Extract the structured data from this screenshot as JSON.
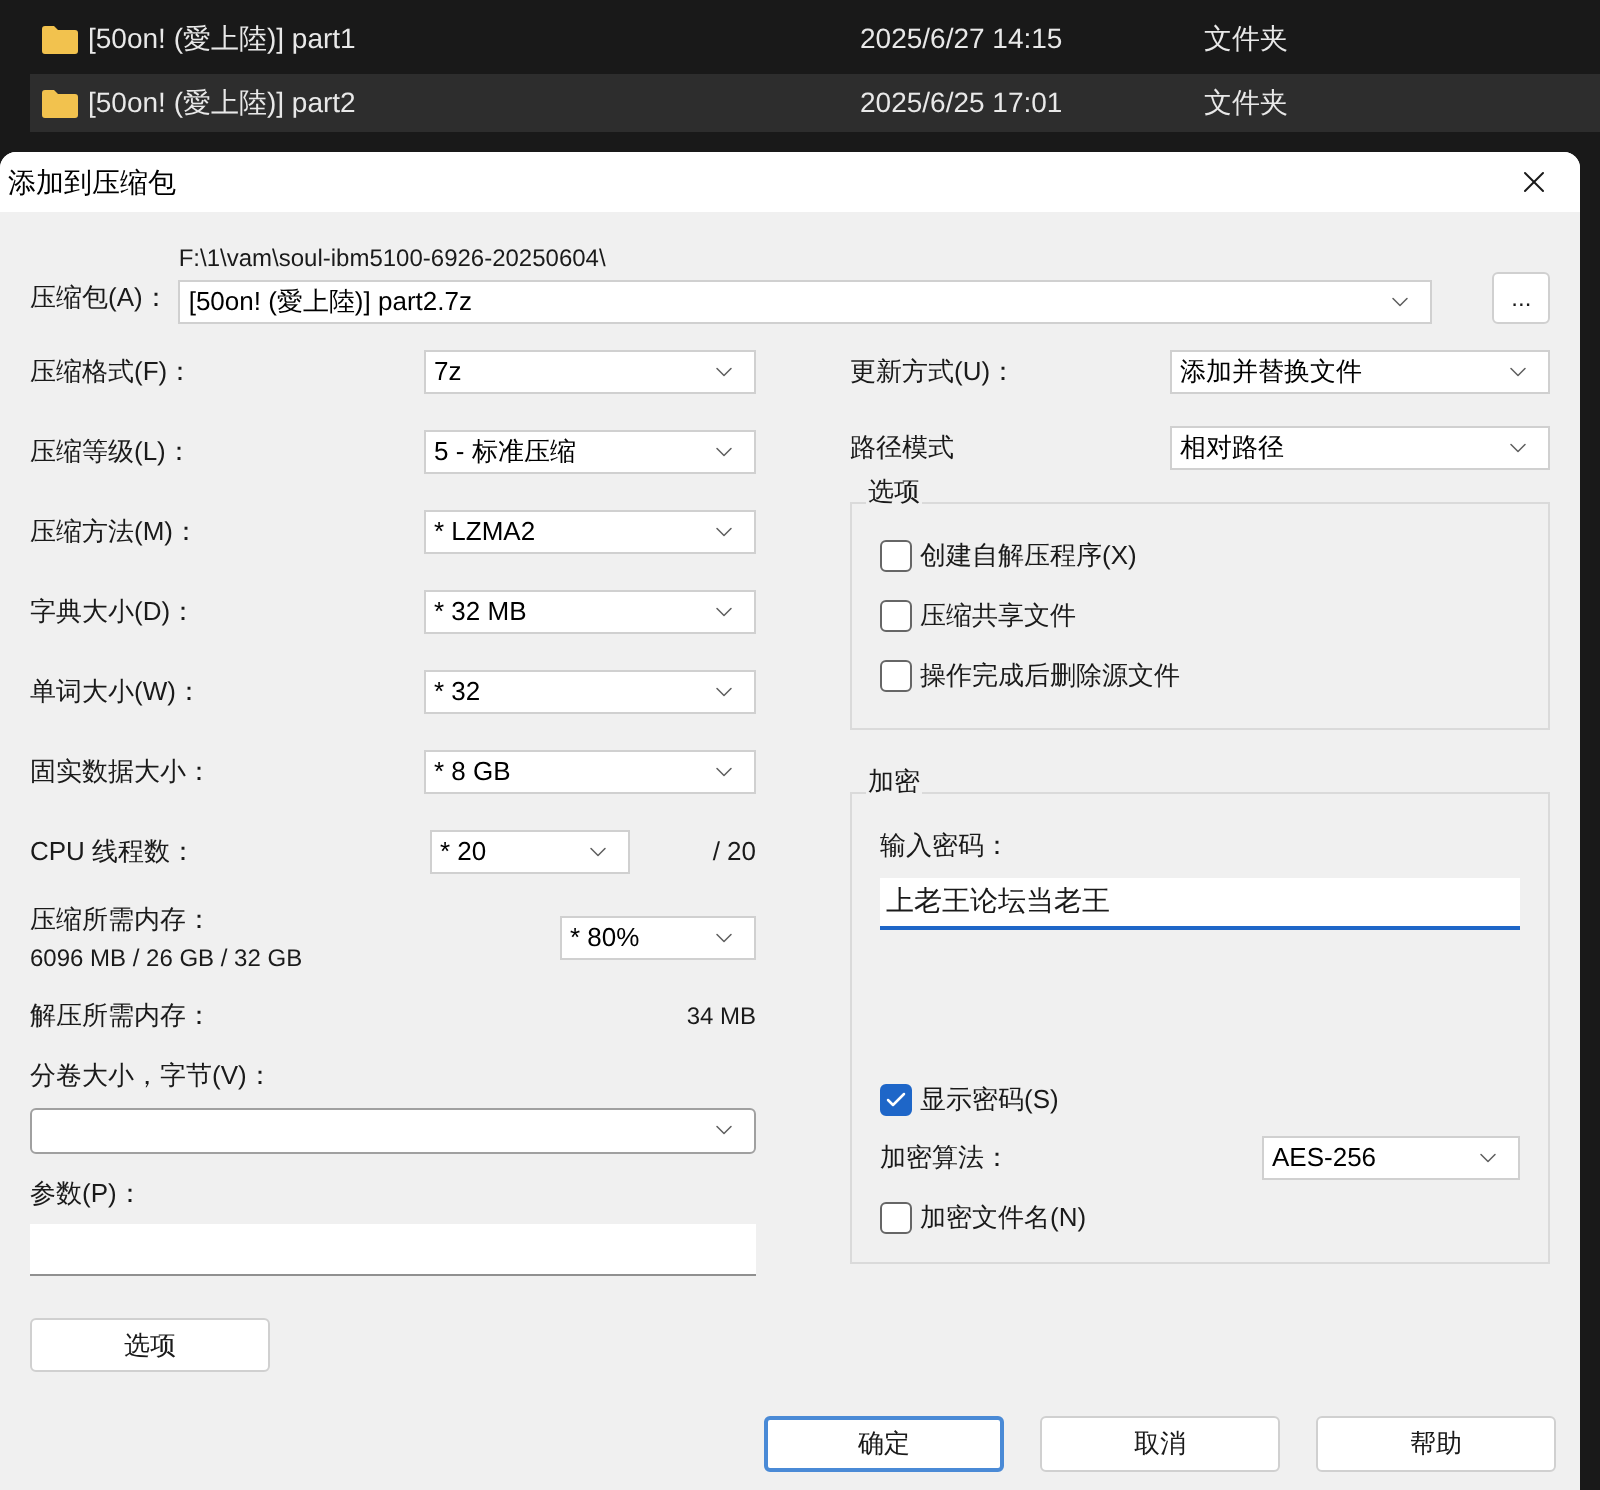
{
  "explorer_rows": [
    {
      "name": "[50on! (愛上陸)] part1",
      "date": "2025/6/27 14:15",
      "type": "文件夹",
      "selected": false
    },
    {
      "name": "[50on! (愛上陸)] part2",
      "date": "2025/6/25 17:01",
      "type": "文件夹",
      "selected": true
    }
  ],
  "dialog": {
    "title": "添加到压缩包",
    "archive": {
      "label": "压缩包(A)：",
      "path": "F:\\1\\vam\\soul-ibm5100-6926-20250604\\",
      "value": "[50on! (愛上陸)] part2.7z",
      "browse": "..."
    },
    "left": [
      {
        "kind": "select",
        "label": "压缩格式(F)：",
        "value": "7z"
      },
      {
        "kind": "select",
        "label": "压缩等级(L)：",
        "value": "5 - 标准压缩"
      },
      {
        "kind": "select",
        "label": "压缩方法(M)：",
        "value": "* LZMA2"
      },
      {
        "kind": "select",
        "label": "字典大小(D)：",
        "value": "* 32 MB"
      },
      {
        "kind": "select",
        "label": "单词大小(W)：",
        "value": "* 32"
      },
      {
        "kind": "select",
        "label": "固实数据大小：",
        "value": "* 8 GB"
      },
      {
        "kind": "threads",
        "label": "CPU 线程数：",
        "value": "* 20",
        "suffix": "/ 20"
      },
      {
        "kind": "memory",
        "label": "压缩所需内存：",
        "detail": "6096 MB / 26 GB / 32 GB",
        "value": "* 80%"
      },
      {
        "kind": "info",
        "label": "解压所需内存：",
        "value": "34 MB"
      },
      {
        "kind": "combo",
        "label": "分卷大小，字节(V)："
      },
      {
        "kind": "field",
        "label": "参数(P)："
      }
    ],
    "options_button": "选项",
    "update": {
      "label": "更新方式(U)：",
      "value": "添加并替换文件"
    },
    "path_mode": {
      "label": "路径模式",
      "value": "相对路径"
    },
    "options": {
      "title": "选项",
      "items": [
        {
          "label": "创建自解压程序(X)",
          "checked": false
        },
        {
          "label": "压缩共享文件",
          "checked": false
        },
        {
          "label": "操作完成后删除源文件",
          "checked": false
        }
      ]
    },
    "encryption": {
      "title": "加密",
      "password_label": "输入密码：",
      "password": "上老王论坛当老王",
      "show_password": {
        "label": "显示密码(S)",
        "checked": true
      },
      "method": {
        "label": "加密算法：",
        "value": "AES-256"
      },
      "encrypt_names": {
        "label": "加密文件名(N)",
        "checked": false
      }
    },
    "buttons": [
      {
        "label": "确定",
        "default": true
      },
      {
        "label": "取消",
        "default": false
      },
      {
        "label": "帮助",
        "default": false
      }
    ]
  }
}
